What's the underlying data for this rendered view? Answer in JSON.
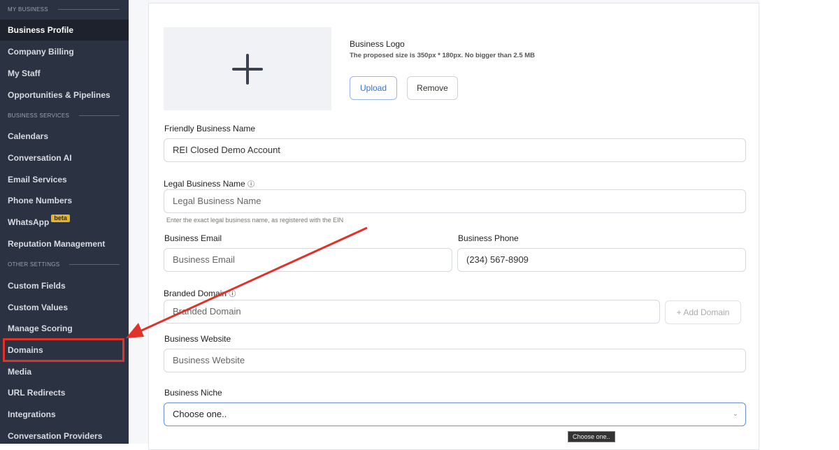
{
  "sidebar": {
    "sections": [
      "MY BUSINESS",
      "BUSINESS SERVICES",
      "OTHER SETTINGS"
    ],
    "items": [
      "Business Profile",
      "Company Billing",
      "My Staff",
      "Opportunities & Pipelines",
      "Calendars",
      "Conversation AI",
      "Email Services",
      "Phone Numbers",
      "WhatsApp",
      "Reputation Management",
      "Custom Fields",
      "Custom Values",
      "Manage Scoring",
      "Domains",
      "Media",
      "URL Redirects",
      "Integrations",
      "Conversation Providers"
    ],
    "beta_badge": "beta"
  },
  "logo": {
    "title": "Business Logo",
    "hint": "The proposed size is 350px * 180px. No bigger than 2.5 MB",
    "upload": "Upload",
    "remove": "Remove"
  },
  "form": {
    "friendly_label": "Friendly Business Name",
    "friendly_value": "REI Closed Demo Account",
    "legal_label": "Legal Business Name",
    "legal_placeholder": "Legal Business Name",
    "legal_help": "Enter the exact legal business name, as registered with the EIN",
    "email_label": "Business Email",
    "email_placeholder": "Business Email",
    "phone_label": "Business Phone",
    "phone_value": "(234) 567-8909",
    "domain_label": "Branded Domain",
    "domain_placeholder": "Branded Domain",
    "add_domain": "Add Domain",
    "website_label": "Business Website",
    "website_placeholder": "Business Website",
    "niche_label": "Business Niche",
    "niche_value": "Choose one..",
    "tooltip": "Choose one.."
  },
  "colors": {
    "accent": "#3b6fd8",
    "annotation": "#e0322b"
  }
}
